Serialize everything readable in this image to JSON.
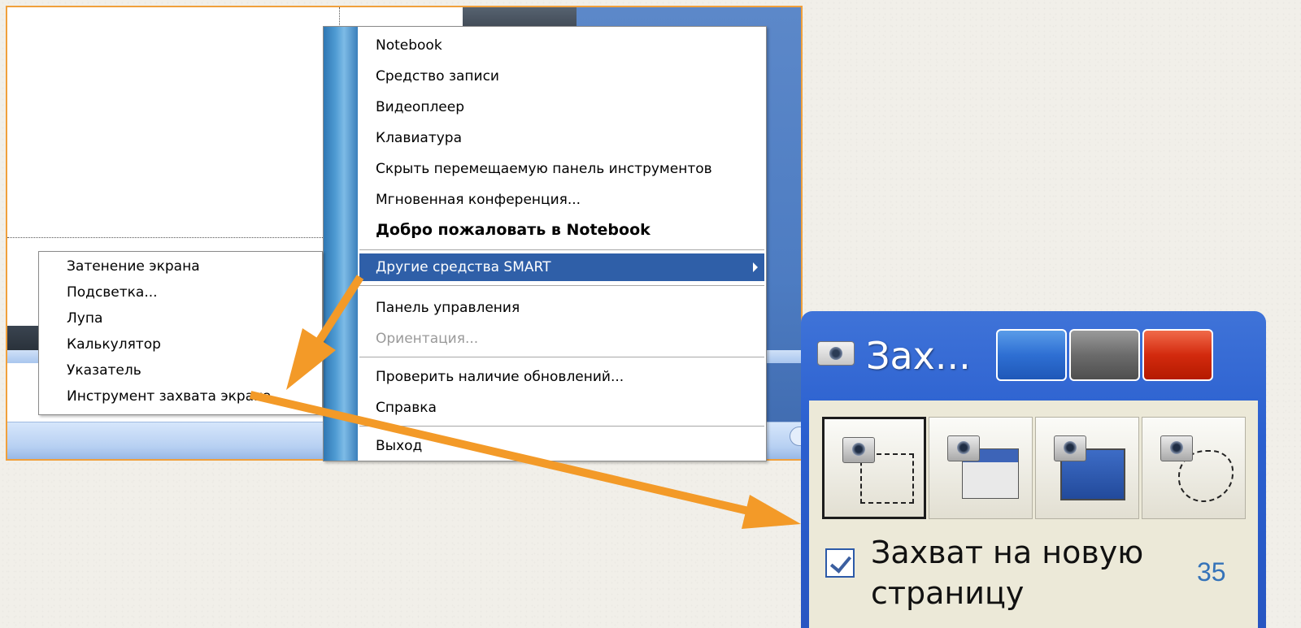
{
  "main_menu": {
    "items": [
      {
        "label": "Notebook",
        "style": "normal"
      },
      {
        "label": "Средство записи",
        "style": "normal"
      },
      {
        "label": "Видеоплеер",
        "style": "normal"
      },
      {
        "label": "Клавиатура",
        "style": "normal"
      },
      {
        "label": "Скрыть перемещаемую панель инструментов",
        "style": "normal"
      },
      {
        "label": "Мгновенная конференция...",
        "style": "normal"
      },
      {
        "label": "Добро пожаловать в Notebook",
        "style": "bold"
      },
      {
        "label": "Другие средства SMART",
        "style": "highlight"
      },
      {
        "label": "Панель управления",
        "style": "normal"
      },
      {
        "label": "Ориентация...",
        "style": "disabled"
      },
      {
        "label": "Проверить наличие обновлений...",
        "style": "normal"
      },
      {
        "label": "Справка",
        "style": "normal"
      },
      {
        "label": "Выход",
        "style": "normal"
      }
    ]
  },
  "submenu": {
    "items": [
      "Затенение экрана",
      "Подсветка...",
      "Лупа",
      "Калькулятор",
      "Указатель",
      "Инструмент захвата экрана"
    ]
  },
  "capture_window": {
    "title": "Зах...",
    "checkbox_label": "Захват на новую страницу",
    "checkbox_checked": true
  },
  "slide_number": "35",
  "colors": {
    "frame_border": "#f0a03c",
    "arrow": "#f39a28",
    "menu_highlight": "#2f5fa8",
    "slide_number": "#3573b9"
  }
}
